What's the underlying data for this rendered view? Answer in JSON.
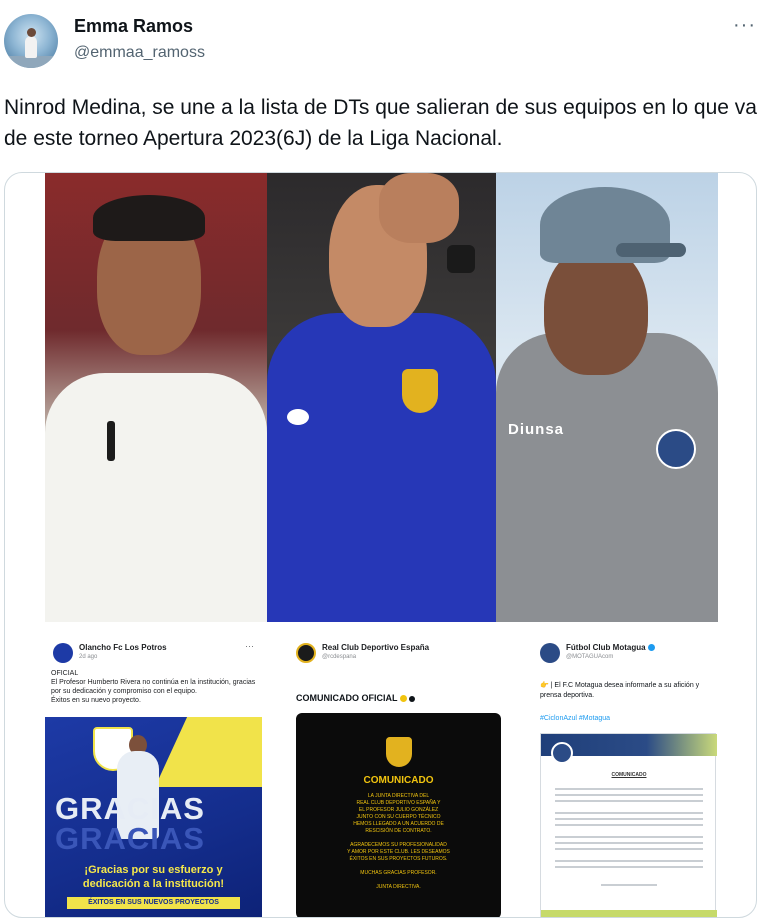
{
  "tweet": {
    "author_name": "Emma Ramos",
    "author_handle": "@emmaa_ramoss",
    "more_icon": "···",
    "text": "Ninrod Medina, se une a la lista de DTs que salieran de sus equipos en lo que va de este torneo Apertura 2023(6J) de la Liga Nacional."
  },
  "media": {
    "photo3_sponsor": "Diunsa",
    "post1": {
      "name": "Olancho Fc Los Potros",
      "meta": "2d ago",
      "text": "OFICIAL\nEl Profesor Humberto Rivera no continúa en la institución, gracias por su dedicación y compromiso con el equipo.\nÉxitos en su nuevo proyecto.",
      "banner_word": "GRACIAS",
      "banner_message": "¡Gracias por su esfuerzo y\ndedicación a la institución!",
      "banner_strip": "ÉXITOS EN SUS NUEVOS PROYECTOS"
    },
    "post2": {
      "name": "Real Club Deportivo España",
      "handle": "@rcdespana",
      "title": "COMUNICADO OFICIAL",
      "board_heading": "COMUNICADO",
      "board_text": "LA JUNTA DIRECTIVA DEL\nREAL CLUB DEPORTIVO ESPAÑA Y\nEL PROFESOR JULIO GONZÁLEZ\nJUNTO CON SU CUERPO TÉCNICO\nHEMOS LLEGADO A UN ACUERDO DE\nRESCISIÓN DE CONTRATO.\n\nAGRADECEMOS SU PROFESIONALIDAD\nY AMOR POR ESTE CLUB. LES DESEAMOS\nÉXITOS EN SUS PROYECTOS FUTUROS.\n\nMUCHAS GRACIAS PROFESOR.\n\nJUNTA DIRECTIVA."
    },
    "post3": {
      "name": "Fútbol Club Motagua",
      "handle": "@MOTAGUAcom",
      "text": "👉 | El F.C Motagua desea informarle a su afición y prensa deportiva.",
      "tags": "#CiclonAzul #Motagua",
      "doc_title": "COMUNICADO"
    }
  }
}
